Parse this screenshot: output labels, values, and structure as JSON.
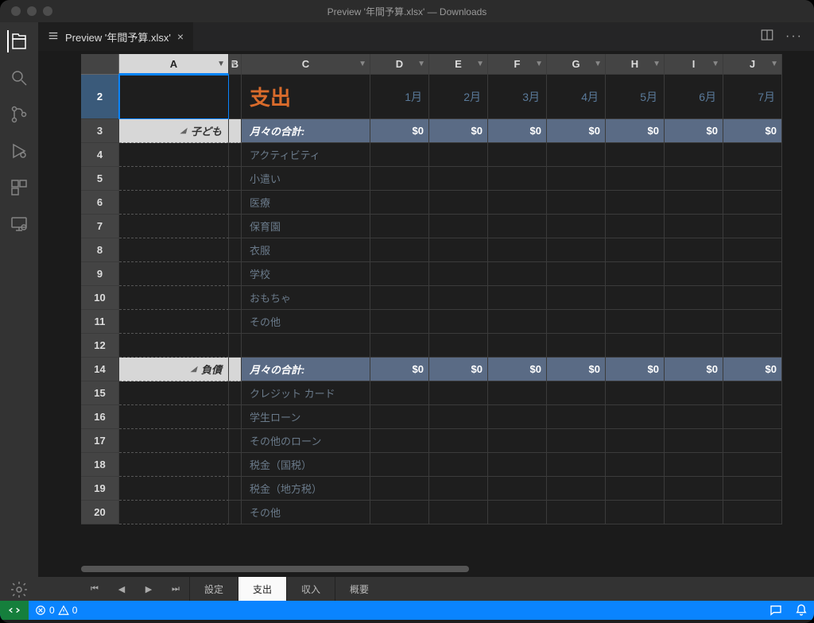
{
  "window_title": "Preview '年間予算.xlsx' — Downloads",
  "tab": {
    "label": "Preview '年間予算.xlsx'"
  },
  "columns": [
    "A",
    "B",
    "C",
    "D",
    "E",
    "F",
    "G",
    "H",
    "I",
    "J"
  ],
  "months": [
    "1月",
    "2月",
    "3月",
    "4月",
    "5月",
    "6月",
    "7月"
  ],
  "bigtitle": "支出",
  "section1": "子ども",
  "section2": "負債",
  "subtotal_label": "月々の合計:",
  "zero": "$0",
  "items1": [
    "アクティビティ",
    "小遣い",
    "医療",
    "保育園",
    "衣服",
    "学校",
    "おもちゃ",
    "その他"
  ],
  "items2": [
    "クレジット カード",
    "学生ローン",
    "その他のローン",
    "税金（国税）",
    "税金（地方税）",
    "その他"
  ],
  "row_numbers_top": [
    "2",
    "3",
    "4",
    "5",
    "6",
    "7",
    "8",
    "9",
    "10",
    "11",
    "12"
  ],
  "row_numbers_sec2": [
    "14",
    "15",
    "16",
    "17",
    "18",
    "19",
    "20"
  ],
  "sheet_tabs": [
    "設定",
    "支出",
    "収入",
    "概要"
  ],
  "active_sheet": "支出",
  "status": {
    "errors": "0",
    "warnings": "0"
  }
}
